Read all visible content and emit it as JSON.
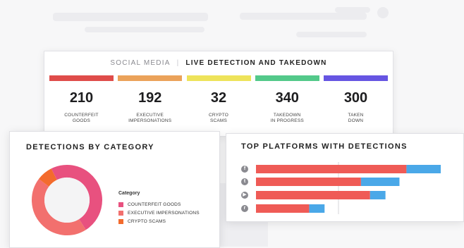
{
  "top_card": {
    "section": "SOCIAL MEDIA",
    "separator": "|",
    "title": "LIVE DETECTION AND TAKEDOWN",
    "stats": [
      {
        "value": "210",
        "label_line1": "COUNTERFEIT",
        "label_line2": "GOODS",
        "color": "#df4c4a"
      },
      {
        "value": "192",
        "label_line1": "EXECUTIVE",
        "label_line2": "IMPERSONATIONS",
        "color": "#eba25a"
      },
      {
        "value": "32",
        "label_line1": "CRYPTO",
        "label_line2": "SCAMS",
        "color": "#eee35a"
      },
      {
        "value": "340",
        "label_line1": "TAKEDOWN",
        "label_line2": "IN PROGRESS",
        "color": "#53c98a"
      },
      {
        "value": "300",
        "label_line1": "TAKEN",
        "label_line2": "DOWN",
        "color": "#6655e2"
      }
    ]
  },
  "detections": {
    "title": "DETECTIONS BY CATEGORY",
    "legend_title": "Category",
    "chart_data": {
      "type": "pie",
      "categories": [
        "COUNTERFEIT GOODS",
        "EXECUTIVE IMPERSONATIONS",
        "CRYPTO SCAMS"
      ],
      "values": [
        210,
        192,
        32
      ],
      "colors": [
        "#e8517f",
        "#f2706e",
        "#f36b2d"
      ]
    }
  },
  "platforms": {
    "title": "TOP PLATFORMS WITH DETECTIONS",
    "icons": [
      "facebook-icon",
      "twitter-icon",
      "youtube-icon",
      "reddit-icon"
    ],
    "icon_glyphs": [
      "f",
      "t",
      "▶",
      "r"
    ],
    "chart_data": {
      "type": "bar",
      "orientation": "horizontal",
      "categories": [
        "facebook",
        "twitter",
        "youtube",
        "reddit"
      ],
      "series": [
        {
          "values": [
            215,
            150,
            163,
            76
          ],
          "color": "#ef5b56"
        },
        {
          "values": [
            49,
            55,
            22,
            22
          ],
          "color": "#4aa8e8"
        }
      ],
      "xlim": [
        0,
        270
      ]
    }
  }
}
